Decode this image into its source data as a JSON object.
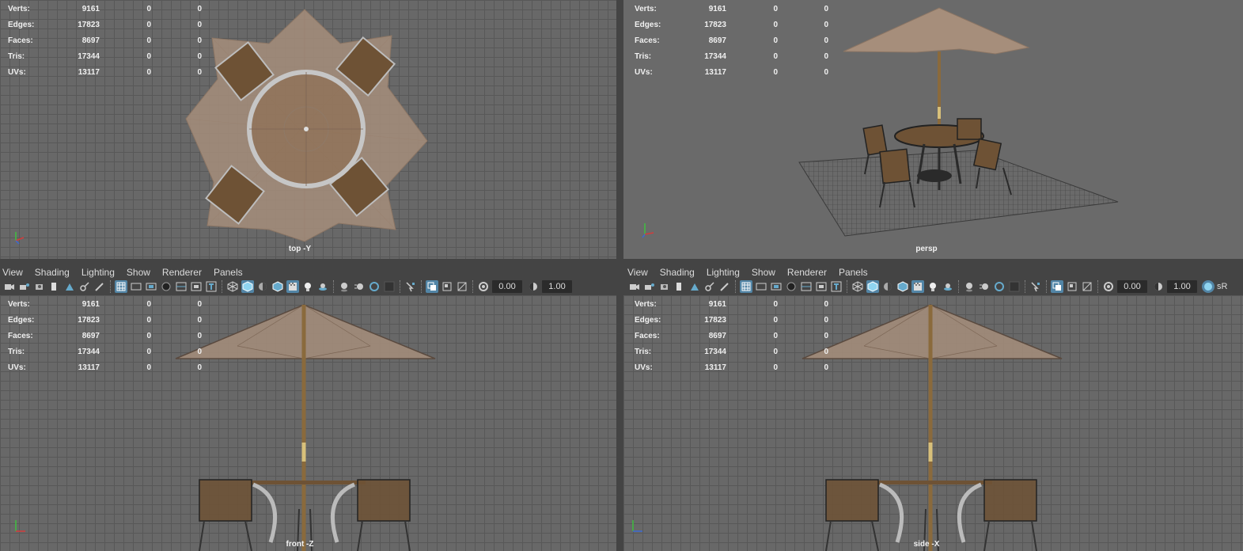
{
  "stats": {
    "labels": [
      "Verts:",
      "Edges:",
      "Faces:",
      "Tris:",
      "UVs:"
    ],
    "values": [
      [
        "9161",
        "0",
        "0"
      ],
      [
        "17823",
        "0",
        "0"
      ],
      [
        "8697",
        "0",
        "0"
      ],
      [
        "17344",
        "0",
        "0"
      ],
      [
        "13117",
        "0",
        "0"
      ]
    ]
  },
  "viewports": {
    "top": {
      "label": "top -Y"
    },
    "persp": {
      "label": "persp"
    },
    "front": {
      "label": "front -Z"
    },
    "side": {
      "label": "side -X"
    }
  },
  "panel_menu": [
    "View",
    "Shading",
    "Lighting",
    "Show",
    "Renderer",
    "Panels"
  ],
  "toolbar": {
    "exposure": "0.00",
    "gamma": "1.00",
    "color_space": "sR"
  },
  "colors": {
    "grid_bg": "#686868",
    "grid_line": "#585858",
    "persp_bg": "#6a6a6a",
    "umbrella": "#a68e7b",
    "wood": "#6e5235",
    "accent": "#5285a6"
  }
}
